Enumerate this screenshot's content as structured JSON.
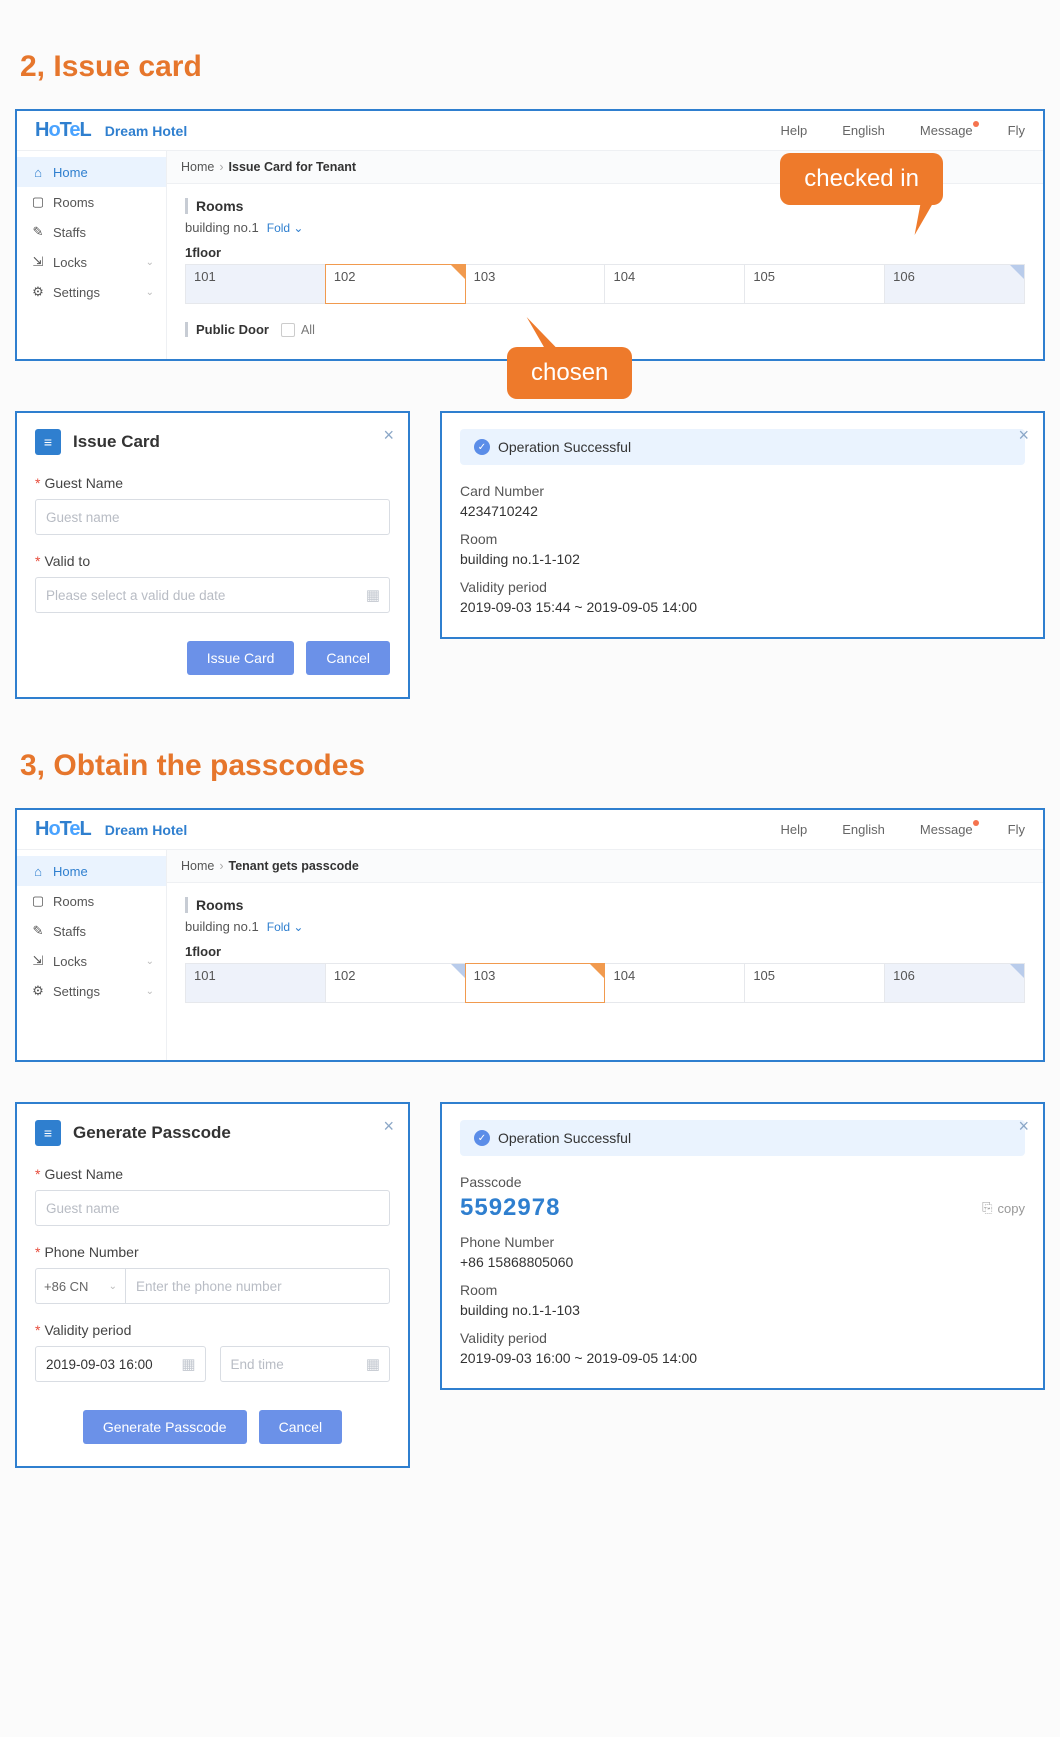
{
  "section2_title": "2, Issue card",
  "section3_title": "3, Obtain the passcodes",
  "callout_checked_in": "checked in",
  "callout_chosen": "chosen",
  "header": {
    "logo_text": "HoTeL",
    "hotel_name": "Dream Hotel",
    "links": {
      "help": "Help",
      "lang": "English",
      "msg": "Message",
      "user": "Fly"
    }
  },
  "sidebar": {
    "items": [
      {
        "label": "Home",
        "icon": "⌂",
        "active": true
      },
      {
        "label": "Rooms",
        "icon": "▢"
      },
      {
        "label": "Staffs",
        "icon": "✎"
      },
      {
        "label": "Locks",
        "icon": "⇲",
        "chev": true
      },
      {
        "label": "Settings",
        "icon": "⚙",
        "chev": true
      }
    ]
  },
  "screen1": {
    "crumb_home": "Home",
    "crumb_page": "Issue Card for Tenant",
    "rooms_head": "Rooms",
    "building": "building no.1",
    "fold": "Fold",
    "floor": "1floor",
    "rooms": [
      {
        "no": "101",
        "occ": true
      },
      {
        "no": "102",
        "sel": true,
        "corner": "orange"
      },
      {
        "no": "103"
      },
      {
        "no": "104"
      },
      {
        "no": "105"
      },
      {
        "no": "106",
        "occ": true,
        "corner": "blue"
      }
    ],
    "public_door": "Public Door",
    "all": "All"
  },
  "issue_dialog": {
    "title": "Issue Card",
    "guest_label": "Guest Name",
    "guest_ph": "Guest name",
    "valid_label": "Valid to",
    "valid_ph": "Please select a valid due date",
    "btn_issue": "Issue Card",
    "btn_cancel": "Cancel"
  },
  "issue_result": {
    "success": "Operation Successful",
    "card_lbl": "Card Number",
    "card_val": "4234710242",
    "room_lbl": "Room",
    "room_val": "building no.1-1-102",
    "valid_lbl": "Validity period",
    "valid_val": "2019-09-03 15:44  ~  2019-09-05 14:00"
  },
  "screen2": {
    "crumb_home": "Home",
    "crumb_page": "Tenant gets passcode",
    "rooms_head": "Rooms",
    "building": "building no.1",
    "fold": "Fold",
    "floor": "1floor",
    "rooms": [
      {
        "no": "101",
        "occ": true
      },
      {
        "no": "102",
        "corner": "blue"
      },
      {
        "no": "103",
        "sel": true,
        "corner": "orange"
      },
      {
        "no": "104"
      },
      {
        "no": "105"
      },
      {
        "no": "106",
        "occ": true,
        "corner": "blue"
      }
    ]
  },
  "pass_dialog": {
    "title": "Generate Passcode",
    "guest_label": "Guest Name",
    "guest_ph": "Guest name",
    "phone_label": "Phone Number",
    "cc": "+86 CN",
    "phone_ph": "Enter the phone number",
    "valid_label": "Validity period",
    "start_val": "2019-09-03 16:00",
    "end_ph": "End time",
    "btn_gen": "Generate Passcode",
    "btn_cancel": "Cancel"
  },
  "pass_result": {
    "success": "Operation Successful",
    "pass_lbl": "Passcode",
    "pass_val": "5592978",
    "copy": "copy",
    "phone_lbl": "Phone Number",
    "phone_val": "+86 15868805060",
    "room_lbl": "Room",
    "room_val": "building no.1-1-103",
    "valid_lbl": "Validity period",
    "valid_val": "2019-09-03 16:00  ~  2019-09-05 14:00"
  }
}
